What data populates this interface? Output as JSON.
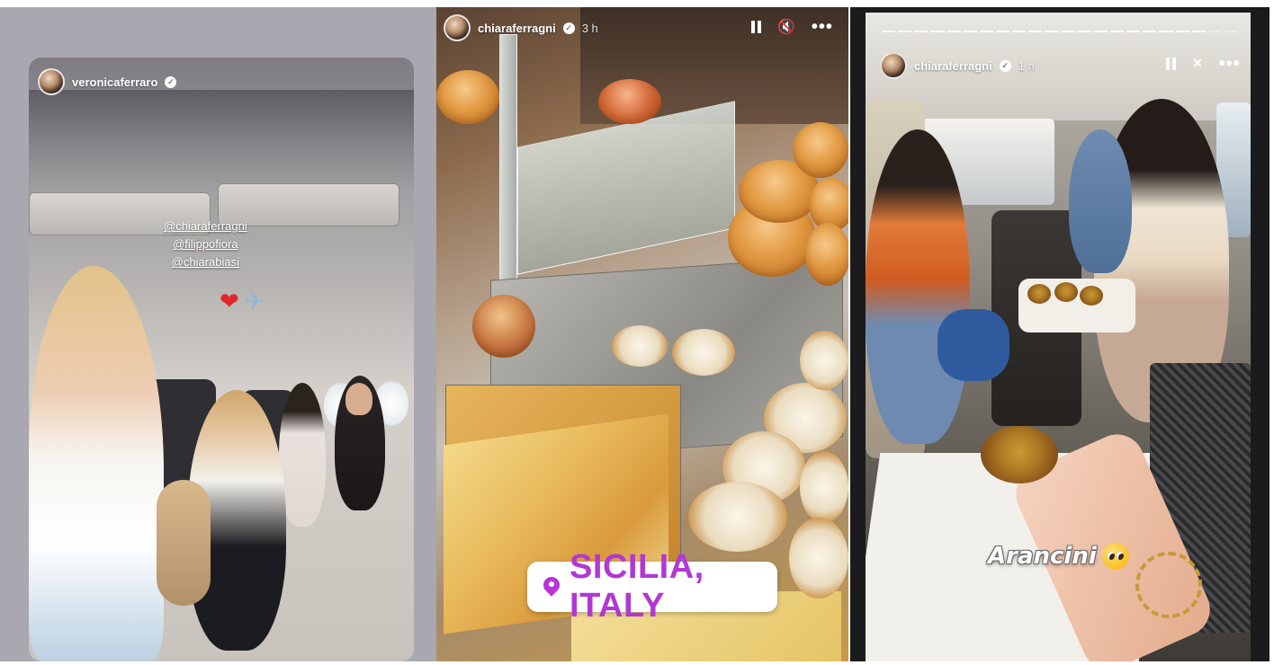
{
  "stories": [
    {
      "username": "veronicaferraro",
      "verified": true,
      "time": "",
      "mentions": [
        "@chiaraferragni",
        "@filippofiora",
        "@chiarabiasi"
      ],
      "stickers": [
        "heart",
        "airplane"
      ]
    },
    {
      "username": "chiaraferragni",
      "verified": true,
      "time": "3 h",
      "location": "SICILIA, ITALY",
      "controls": [
        "pause-icon",
        "mute-icon",
        "more-icon"
      ]
    },
    {
      "username": "chiaraferragni",
      "verified": true,
      "time": "1 h",
      "caption": "Arancini",
      "caption_emoji": "pleading-face",
      "controls": [
        "pause-icon",
        "mute-icon",
        "more-icon"
      ],
      "progress_segments": 22,
      "progress_active": 20
    }
  ],
  "glyphs": {
    "heart": "❤",
    "airplane": "✈",
    "verified": "✓",
    "mute_p2": "🔇",
    "mute_p3": "✕",
    "more": "•••"
  }
}
